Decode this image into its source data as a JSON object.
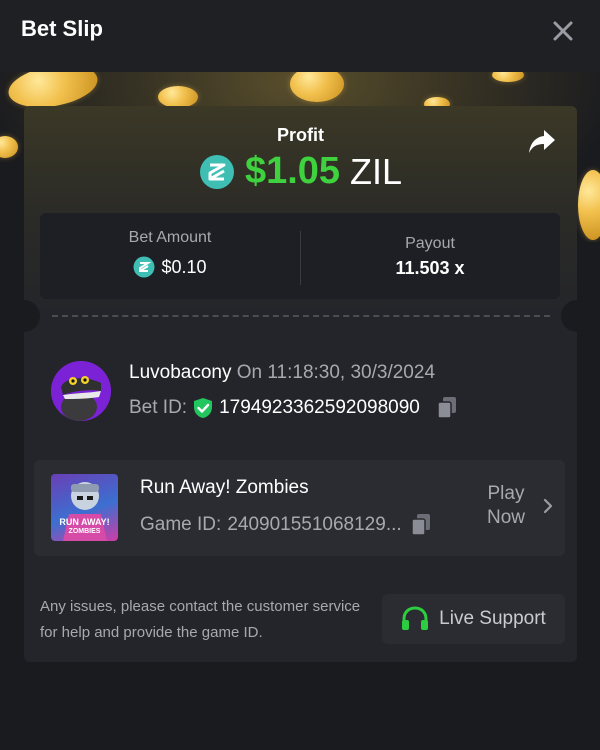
{
  "header": {
    "title": "Bet Slip",
    "close_icon": "close-icon"
  },
  "profit": {
    "label": "Profit",
    "amount": "$1.05",
    "currency": "ZIL",
    "currency_icon": "zilliqa-coin-icon",
    "amount_color": "#3fd23f",
    "share_icon": "share-icon"
  },
  "stats": {
    "bet_amount_label": "Bet Amount",
    "bet_amount_value": "$0.10",
    "payout_label": "Payout",
    "payout_value": "11.503 x"
  },
  "bet": {
    "username": "Luvobacony",
    "on_time": "On 11:18:30, 30/3/2024",
    "bet_id_label": "Bet ID:",
    "bet_id_value": "1794923362592098090",
    "verified_icon": "shield-check-icon",
    "copy_icon": "copy-icon"
  },
  "game": {
    "name": "Run Away! Zombies",
    "game_id_label": "Game ID:",
    "game_id_value": "240901551068129...",
    "thumb_text_line1": "RUN AWAY!",
    "thumb_text_line2": "ZOMBIES",
    "play_line1": "Play",
    "play_line2": "Now",
    "chevron_icon": "chevron-right-icon"
  },
  "footer": {
    "issue_text": "Any issues, please contact the customer service for help and provide the game ID.",
    "live_support_label": "Live Support",
    "headset_icon": "headset-icon",
    "support_color": "#2ecc40"
  }
}
